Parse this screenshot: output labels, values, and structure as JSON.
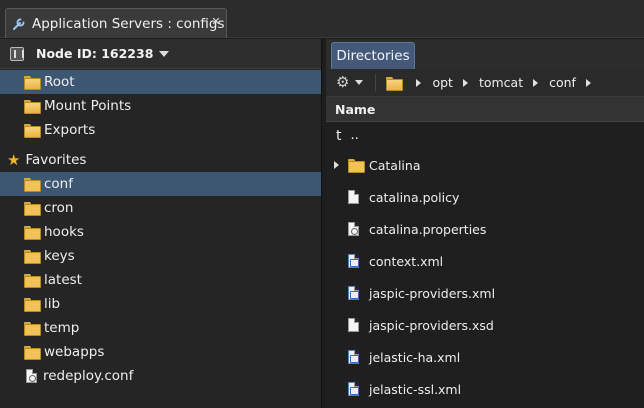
{
  "window": {
    "tab_title": "Application Servers : configs",
    "close_glyph": "✕"
  },
  "left_panel": {
    "node_label": "Node ID: 162238",
    "tree_top": [
      {
        "label": "Root",
        "icon": "folder-open-icon",
        "selected": true
      },
      {
        "label": "Mount Points",
        "icon": "folder-open-icon",
        "selected": false
      },
      {
        "label": "Exports",
        "icon": "folder-open-icon",
        "selected": false
      }
    ],
    "favorites_label": "Favorites",
    "favorites": [
      {
        "label": "conf",
        "icon": "folder-icon",
        "selected": true
      },
      {
        "label": "cron",
        "icon": "folder-icon",
        "selected": false
      },
      {
        "label": "hooks",
        "icon": "folder-icon",
        "selected": false
      },
      {
        "label": "keys",
        "icon": "folder-icon",
        "selected": false
      },
      {
        "label": "latest",
        "icon": "folder-icon",
        "selected": false
      },
      {
        "label": "lib",
        "icon": "folder-icon",
        "selected": false
      },
      {
        "label": "temp",
        "icon": "folder-icon",
        "selected": false
      },
      {
        "label": "webapps",
        "icon": "folder-icon",
        "selected": false
      },
      {
        "label": "redeploy.conf",
        "icon": "config-file-icon",
        "selected": false
      }
    ]
  },
  "right_panel": {
    "tab_label": "Directories",
    "breadcrumb": [
      "opt",
      "tomcat",
      "conf"
    ],
    "column_name": "Name",
    "up_label": "..",
    "up_glyph": "t",
    "files": [
      {
        "name": "Catalina",
        "type": "folder",
        "expandable": true
      },
      {
        "name": "catalina.policy",
        "type": "file"
      },
      {
        "name": "catalina.properties",
        "type": "config"
      },
      {
        "name": "context.xml",
        "type": "xml"
      },
      {
        "name": "jaspic-providers.xml",
        "type": "xml"
      },
      {
        "name": "jaspic-providers.xsd",
        "type": "file"
      },
      {
        "name": "jelastic-ha.xml",
        "type": "xml"
      },
      {
        "name": "jelastic-ssl.xml",
        "type": "xml"
      }
    ]
  },
  "colors": {
    "selection": "#3d5672",
    "tab_active": "#44597a",
    "folder": "#f2c25a"
  }
}
